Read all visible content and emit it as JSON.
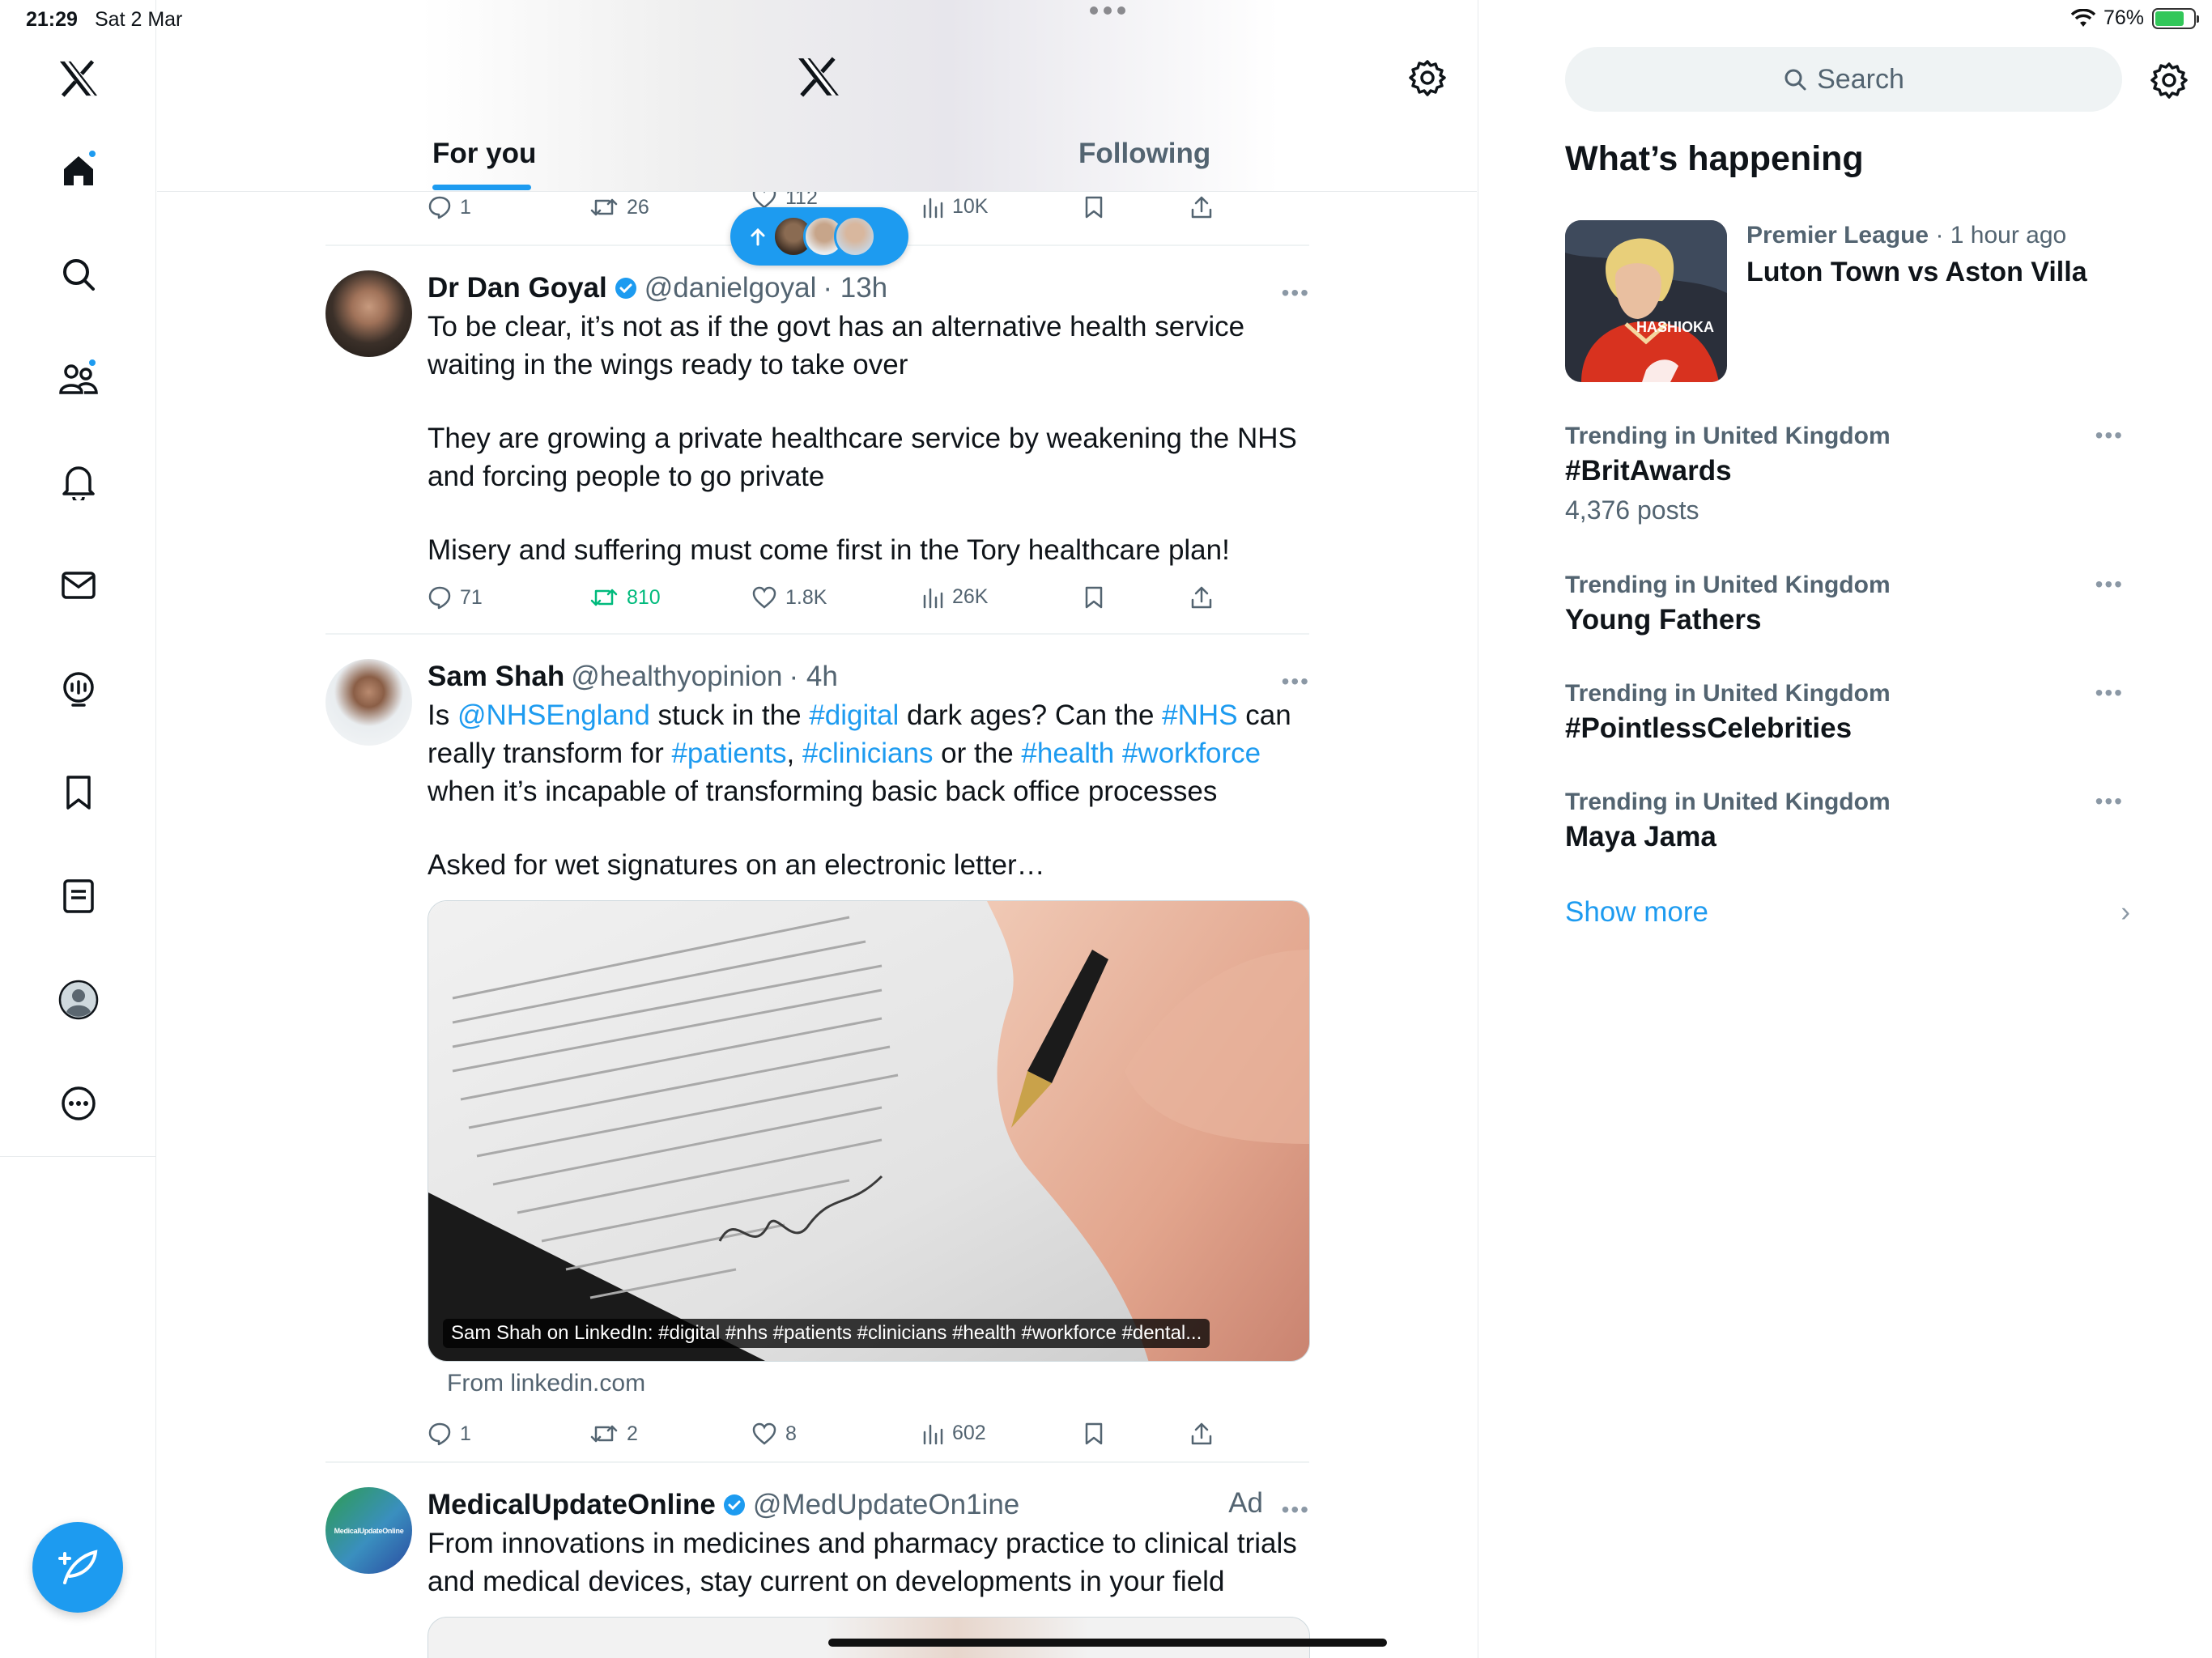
{
  "status": {
    "time": "21:29",
    "date": "Sat 2 Mar",
    "battery": "76%",
    "battery_level": 0.76
  },
  "header": {
    "tabs": [
      {
        "label": "For you"
      },
      {
        "label": "Following"
      }
    ]
  },
  "tweets": [
    {
      "partial": true,
      "actions": {
        "replies": "1",
        "reposts": "26",
        "likes": "112",
        "views": "10K"
      }
    },
    {
      "name": "Dr Dan Goyal",
      "handle": "@danielgoyal",
      "time": "· 13h",
      "verified": true,
      "paragraphs": [
        "To be clear, it’s not as if the govt has an alternative health service waiting in the wings ready to take over",
        "They are growing a private healthcare service by weakening the NHS and forcing people to go private",
        "Misery and suffering must come first in the Tory healthcare plan!"
      ],
      "actions": {
        "replies": "71",
        "reposts": "810",
        "likes": "1.8K",
        "views": "26K"
      }
    },
    {
      "name": "Sam Shah",
      "handle": "@healthyopinion",
      "time": "· 4h",
      "text": {
        "s1": "Is ",
        "m1": "@NHSEngland",
        "s2": " stuck in the ",
        "h1": "#digital",
        "s3": " dark ages? Can the ",
        "h2": "#NHS",
        "s4": " can really transform for ",
        "h3": "#patients",
        "s5": ", ",
        "h4": "#clinicians",
        "s6": " or the ",
        "h5": "#health",
        "s7": " ",
        "h6": "#workforce",
        "s8": " when it’s incapable of transforming basic back office processes",
        "p2": "Asked for wet signatures on an electronic letter…"
      },
      "card": {
        "caption": "Sam Shah on LinkedIn: #digital #nhs #patients #clinicians #health #workforce #dental...",
        "source": "From linkedin.com"
      },
      "actions": {
        "replies": "1",
        "reposts": "2",
        "likes": "8",
        "views": "602"
      }
    },
    {
      "name": "MedicalUpdateOnline",
      "handle": "@MedUpdateOn1ine",
      "ad": "Ad",
      "verified": true,
      "avatar_text": "MedicalUpdateOnline",
      "text": "From innovations in medicines and pharmacy practice to clinical trials and medical devices, stay current on developments in your field"
    }
  ],
  "right": {
    "search_placeholder": "Search",
    "section_title": "What’s happening",
    "event": {
      "category": "Premier League",
      "time": " · 1 hour ago",
      "title": "Luton Town vs Aston Villa",
      "shirt_text": "HASHIOKA"
    },
    "trends": [
      {
        "category": "Trending in United Kingdom",
        "name": "#BritAwards",
        "count": "4,376 posts"
      },
      {
        "category": "Trending in United Kingdom",
        "name": "Young Fathers"
      },
      {
        "category": "Trending in United Kingdom",
        "name": "#PointlessCelebrities"
      },
      {
        "category": "Trending in United Kingdom",
        "name": "Maya Jama"
      }
    ],
    "show_more": "Show more"
  },
  "colors": {
    "accent": "#1d9bf0",
    "repost_active": "#00ba7c",
    "muted": "#536471"
  }
}
